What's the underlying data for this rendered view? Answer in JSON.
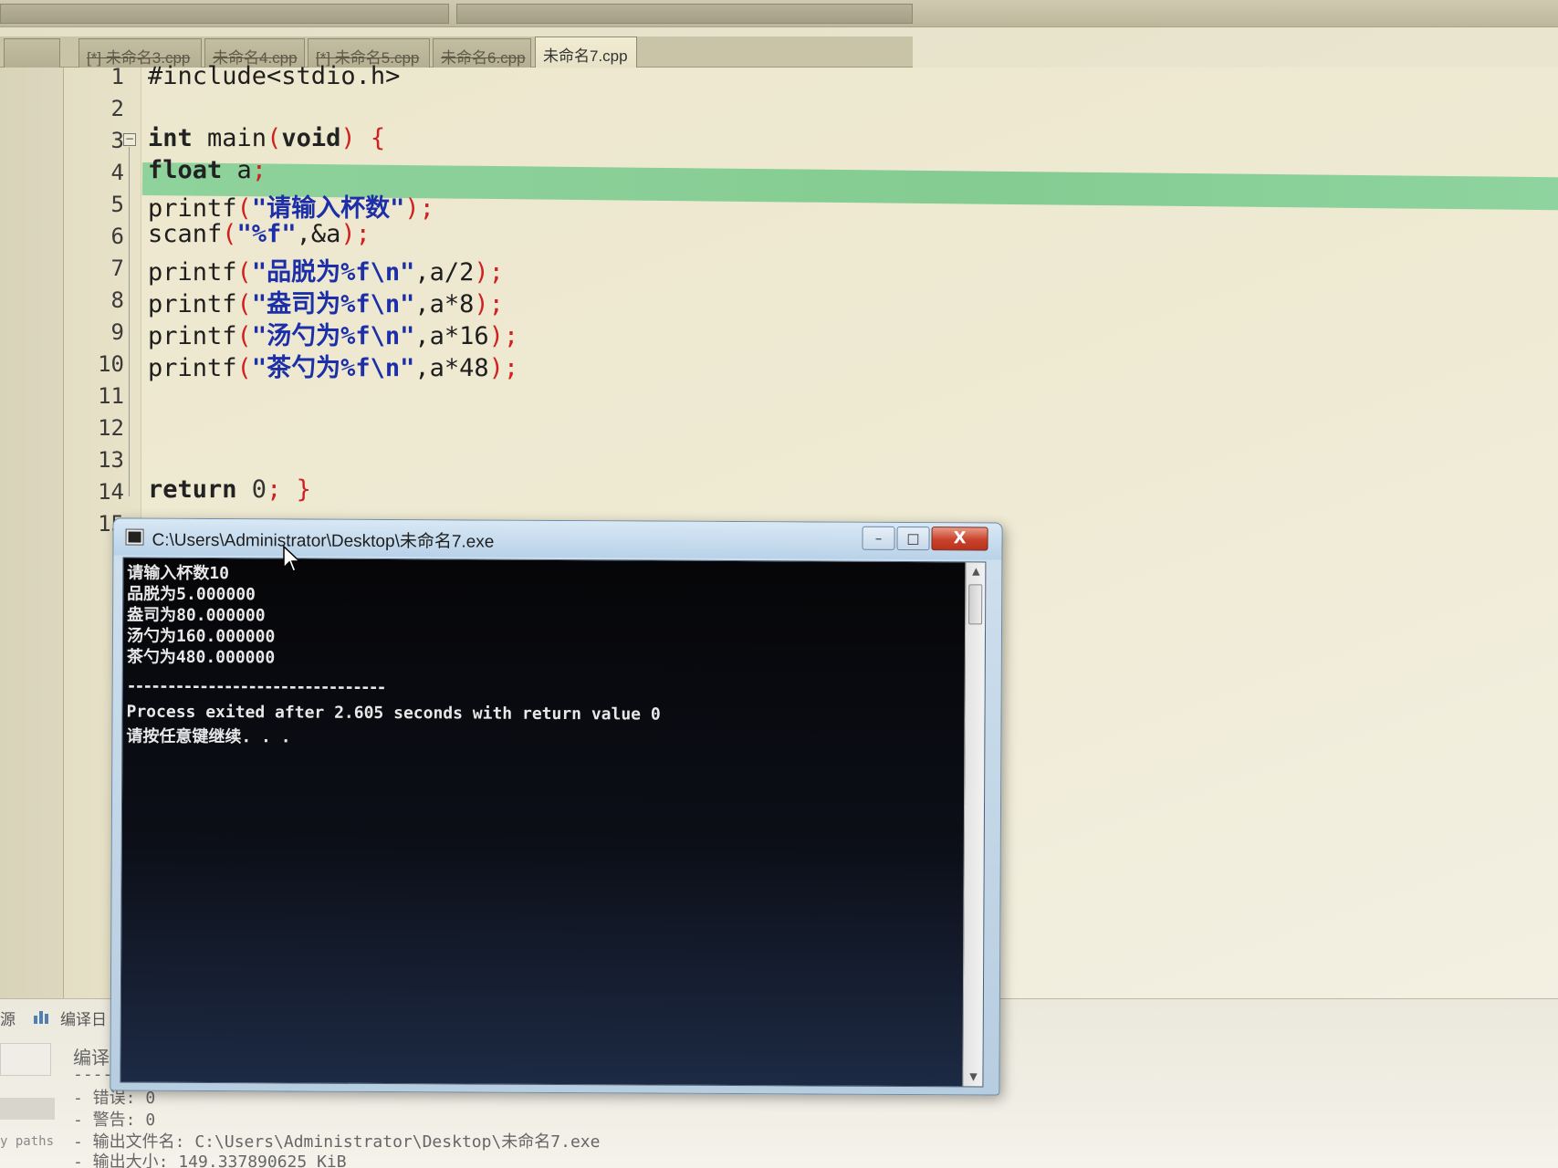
{
  "tabs": [
    {
      "label": "[*] 未命名3.cpp",
      "active": false
    },
    {
      "label": "未命名4.cpp",
      "active": false
    },
    {
      "label": "[*] 未命名5.cpp",
      "active": false
    },
    {
      "label": "未命名6.cpp",
      "active": false
    },
    {
      "label": "未命名7.cpp",
      "active": true
    }
  ],
  "editor": {
    "line_numbers": [
      "1",
      "2",
      "3",
      "4",
      "5",
      "6",
      "7",
      "8",
      "9",
      "10",
      "11",
      "12",
      "13",
      "14",
      "15"
    ],
    "lines": {
      "l1": "#include<stdio.h>",
      "l3_kw": "int",
      "l3_rest": " main",
      "l3_paren": "(",
      "l3_void": "void",
      "l3_paren2": ")",
      "l3_brace": " {",
      "l4_kw": "float",
      "l4_rest": " a",
      "l4_semi": ";",
      "l5_fn": "printf",
      "l5_str": "\"请输入杯数\"",
      "l6_fn": "scanf",
      "l6_str": "\"%f\"",
      "l6_rest": ",&a",
      "l7_fn": "printf",
      "l7_str": "\"品脱为%f\\n\"",
      "l7_rest": ",a/2",
      "l8_fn": "printf",
      "l8_str": "\"盎司为%f\\n\"",
      "l8_rest": ",a*8",
      "l9_fn": "printf",
      "l9_str": "\"汤勺为%f\\n\"",
      "l9_rest": ",a*16",
      "l10_fn": "printf",
      "l10_str": "\"茶勺为%f\\n\"",
      "l10_rest": ",a*48",
      "l14_kw": "return",
      "l14_num": " 0",
      "l14_semi": ";",
      "l14_brace": " }",
      "open_paren": "(",
      "close_paren_semi": ");"
    },
    "highlight_line_color": "#8fd29c"
  },
  "console": {
    "title": "C:\\Users\\Administrator\\Desktop\\未命名7.exe",
    "minimize": "–",
    "maximize": "□",
    "close": "X",
    "output": [
      "请输入杯数10",
      "品脱为5.000000",
      "盎司为80.000000",
      "汤勺为160.000000",
      "茶勺为480.000000",
      "",
      "--------------------------------",
      "Process exited after 2.605 seconds with return value 0",
      "请按任意键继续. . ."
    ]
  },
  "bottom_panel": {
    "tab_icon": "chart-icon",
    "tab_label": "编译日",
    "left_tab": "源",
    "heading": "编译",
    "separator": "----",
    "lines": [
      "- 错误: 0",
      "- 警告: 0",
      "- 输出文件名: C:\\Users\\Administrator\\Desktop\\未命名7.exe",
      "- 输出大小: 149.337890625 KiB"
    ],
    "side_label": "y paths"
  },
  "colors": {
    "accent_close": "#c9432c",
    "string_color": "#1d2fa8",
    "punct_color": "#d02020"
  }
}
